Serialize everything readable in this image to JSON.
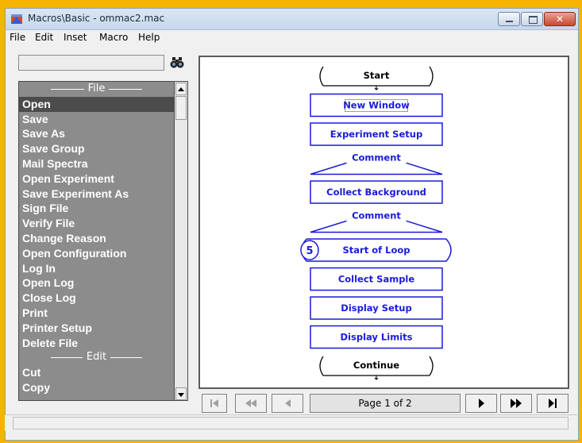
{
  "window": {
    "title": "Macros\\Basic - ommac2.mac"
  },
  "menu": [
    "File",
    "Edit",
    "Inset",
    "Macro",
    "Help"
  ],
  "search": {
    "value": ""
  },
  "list": [
    {
      "kind": "section",
      "label": "File"
    },
    {
      "kind": "item",
      "label": "Open",
      "selected": true
    },
    {
      "kind": "item",
      "label": "Save"
    },
    {
      "kind": "item",
      "label": "Save As"
    },
    {
      "kind": "item",
      "label": "Save Group"
    },
    {
      "kind": "item",
      "label": "Mail Spectra"
    },
    {
      "kind": "item",
      "label": "Open Experiment"
    },
    {
      "kind": "item",
      "label": "Save Experiment As"
    },
    {
      "kind": "item",
      "label": "Sign File"
    },
    {
      "kind": "item",
      "label": "Verify File"
    },
    {
      "kind": "item",
      "label": "Change Reason"
    },
    {
      "kind": "item",
      "label": "Open Configuration"
    },
    {
      "kind": "item",
      "label": "Log In"
    },
    {
      "kind": "item",
      "label": "Open Log"
    },
    {
      "kind": "item",
      "label": "Close Log"
    },
    {
      "kind": "item",
      "label": "Print"
    },
    {
      "kind": "item",
      "label": "Printer Setup"
    },
    {
      "kind": "item",
      "label": "Delete File"
    },
    {
      "kind": "section",
      "label": "Edit"
    },
    {
      "kind": "item",
      "label": "Cut"
    },
    {
      "kind": "item",
      "label": "Copy"
    }
  ],
  "flow": [
    {
      "type": "terminal",
      "label": "Start"
    },
    {
      "type": "step",
      "label": "New Window",
      "focused": true
    },
    {
      "type": "step",
      "label": "Experiment Setup"
    },
    {
      "type": "comment",
      "label": "Comment"
    },
    {
      "type": "step",
      "label": "Collect Background"
    },
    {
      "type": "comment",
      "label": "Comment"
    },
    {
      "type": "loop",
      "label": "Start of Loop",
      "count": "5"
    },
    {
      "type": "step",
      "label": "Collect Sample"
    },
    {
      "type": "step",
      "label": "Display Setup"
    },
    {
      "type": "step",
      "label": "Display Limits"
    },
    {
      "type": "terminal",
      "label": "Continue"
    }
  ],
  "pager": {
    "label": "Page 1 of 2"
  },
  "colors": {
    "flow": "#1a1adc",
    "list_bg": "#8c8c8c",
    "outer": "#f6b400"
  }
}
